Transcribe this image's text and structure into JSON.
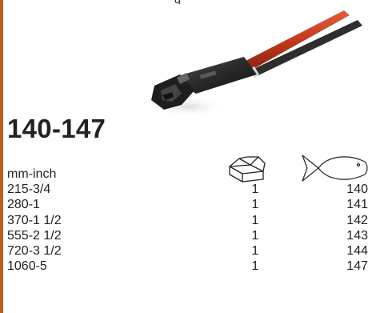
{
  "header": {
    "cut_text": "g"
  },
  "product": {
    "title": "140-147"
  },
  "table": {
    "unit_label": "mm-inch",
    "rows": [
      {
        "size": "215-3/4",
        "qty": "1",
        "number": "140"
      },
      {
        "size": "280-1",
        "qty": "1",
        "number": "141"
      },
      {
        "size": "370-1 1/2",
        "qty": "1",
        "number": "142"
      },
      {
        "size": "555-2 1/2",
        "qty": "1",
        "number": "143"
      },
      {
        "size": "720-3 1/2",
        "qty": "1",
        "number": "144"
      },
      {
        "size": "1060-5",
        "qty": "1",
        "number": "147"
      }
    ]
  },
  "icons": {
    "pack": "package-box-icon",
    "item": "fish-icon"
  },
  "colors": {
    "border": "#b8621c",
    "handle_orange": "#c8442a"
  }
}
